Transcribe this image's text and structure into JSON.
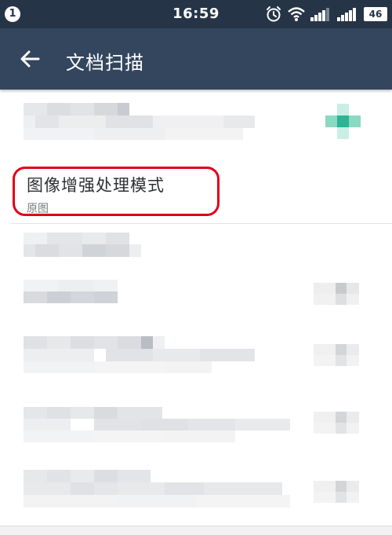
{
  "status_bar": {
    "notification_count": "1",
    "time": "16:59",
    "battery": "46",
    "icons": [
      "alarm-icon",
      "wifi-icon",
      "signal-2g-icon",
      "signal-4g-icon",
      "battery-icon"
    ]
  },
  "app_bar": {
    "back_icon": "arrow-back-icon",
    "title": "文档扫描"
  },
  "settings": {
    "enhance_mode": {
      "title": "图像增强处理模式",
      "value": "原图"
    }
  },
  "colors": {
    "status_bar_bg": "#263448",
    "app_bar_bg": "#33465e",
    "highlight": "#e0001a",
    "accent_toggle": "#2bb594"
  }
}
